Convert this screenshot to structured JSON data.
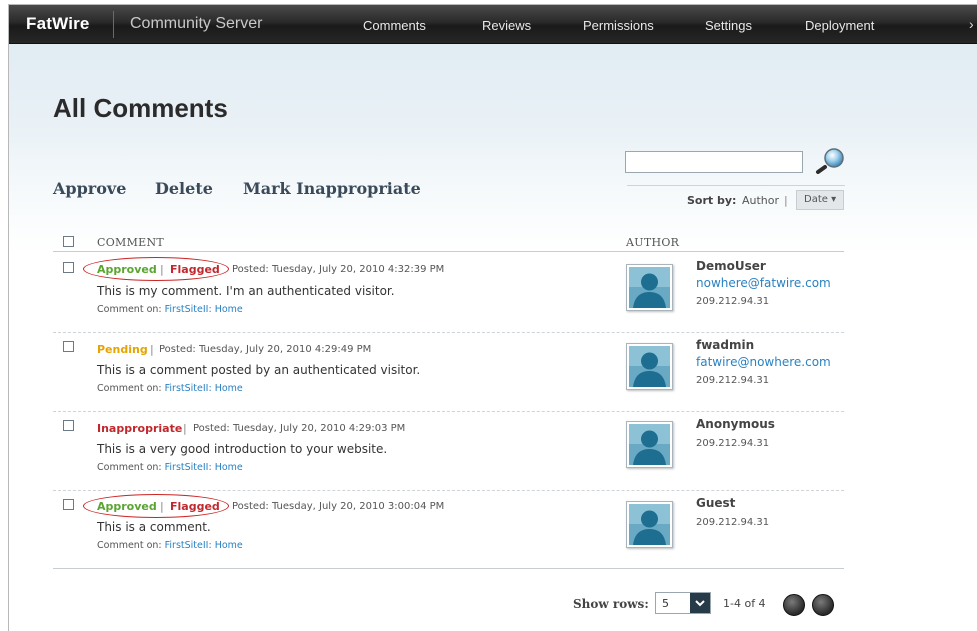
{
  "header": {
    "brand": "FatWire",
    "product": "Community Server",
    "nav": [
      "Comments",
      "Reviews",
      "Permissions",
      "Settings",
      "Deployment"
    ],
    "more": "›"
  },
  "page": {
    "title": "All Comments",
    "actions": {
      "approve": "Approve",
      "delete": "Delete",
      "mark": "Mark Inappropriate"
    }
  },
  "search": {
    "value": "",
    "placeholder": ""
  },
  "sort": {
    "label": "Sort by:",
    "author": "Author",
    "pipe": "|",
    "date": "Date ▾"
  },
  "columns": {
    "comment": "COMMENT",
    "author": "AUTHOR"
  },
  "comments": [
    {
      "status1": "Approved",
      "pipe": "|",
      "status2": "Flagged",
      "posted": "Posted: Tuesday, July 20, 2010 4:32:39 PM",
      "text": "This is my comment. I'm an authenticated visitor.",
      "on_label": "Comment on:",
      "on_link": "FirstSiteII: Home",
      "author": "DemoUser",
      "email": "nowhere@fatwire.com",
      "ip": "209.212.94.31"
    },
    {
      "status1": "Pending",
      "pipe": "|",
      "posted": "Posted: Tuesday, July 20, 2010 4:29:49 PM",
      "text": "This is a comment posted by an authenticated visitor.",
      "on_label": "Comment on:",
      "on_link": "FirstSiteII: Home",
      "author": "fwadmin",
      "email": "fatwire@nowhere.com",
      "ip": "209.212.94.31"
    },
    {
      "status1": "Inappropriate",
      "pipe": "|",
      "posted": "Posted: Tuesday, July 20, 2010 4:29:03 PM",
      "text": "This is a very good introduction to your website.",
      "on_label": "Comment on:",
      "on_link": "FirstSiteII: Home",
      "author": "Anonymous",
      "ip": "209.212.94.31"
    },
    {
      "status1": "Approved",
      "pipe": "|",
      "status2": "Flagged",
      "posted": "Posted: Tuesday, July 20, 2010 3:00:04 PM",
      "text": "This is a comment.",
      "on_label": "Comment on:",
      "on_link": "FirstSiteII: Home",
      "author": "Guest",
      "ip": "209.212.94.31"
    }
  ],
  "footer": {
    "show_rows_label": "Show rows:",
    "rows_value": "5",
    "count": "1-4 of 4"
  },
  "colors": {
    "approved": "#5aa532",
    "flagged": "#c0282d",
    "pending": "#e5a400",
    "link": "#2a82c2",
    "annotation": "#cc2222"
  },
  "icons": [
    "search-icon",
    "avatar-icon",
    "chevron-down-icon",
    "prev-page-icon",
    "next-page-icon"
  ]
}
